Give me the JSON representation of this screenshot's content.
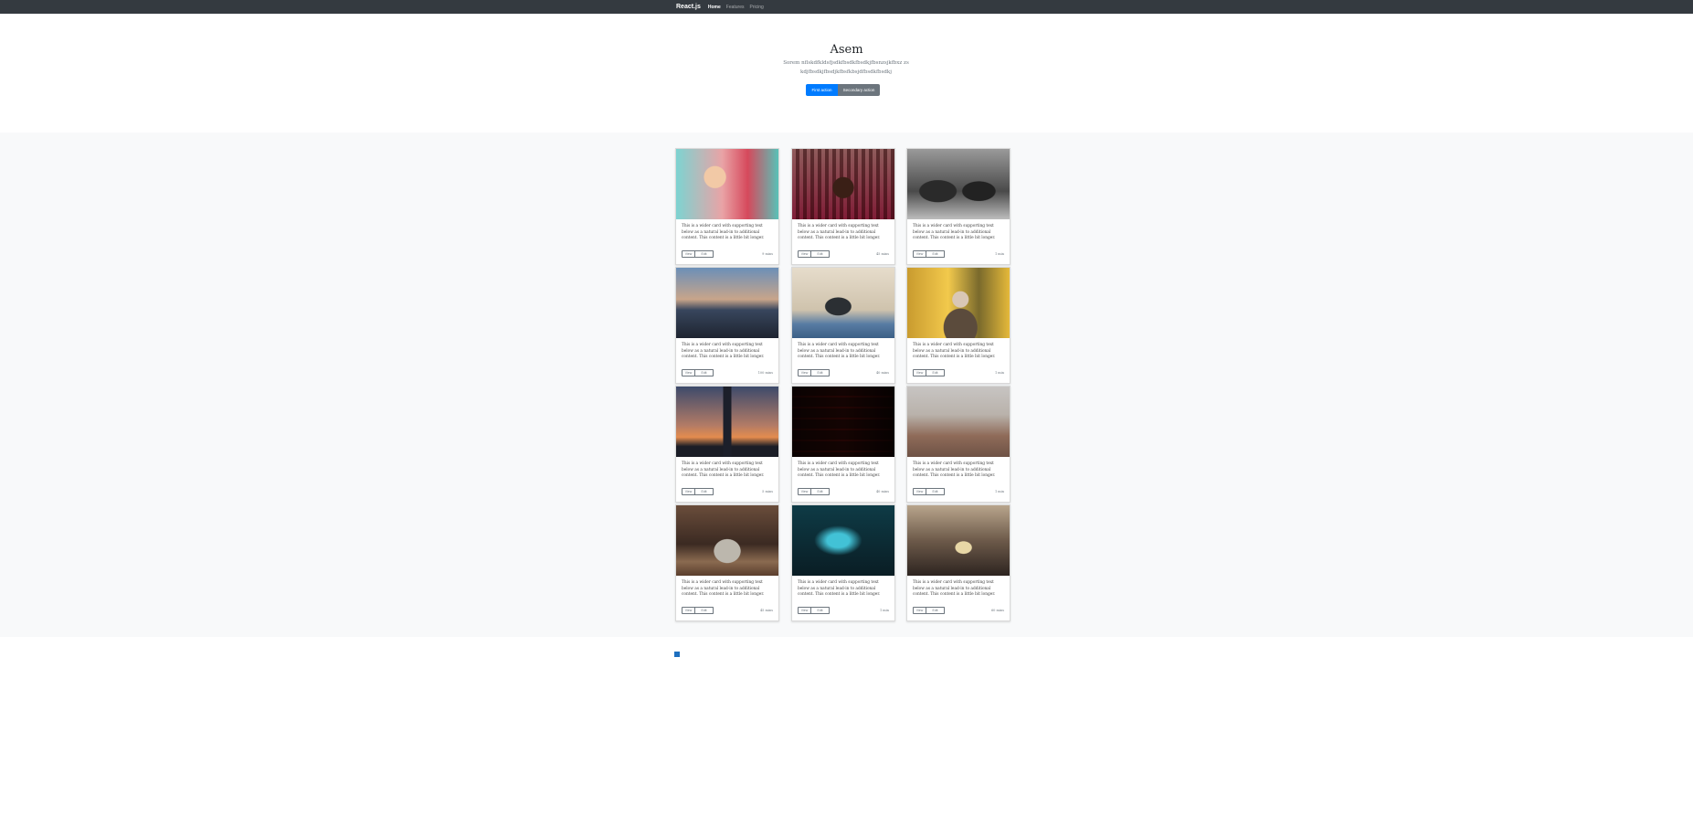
{
  "navbar": {
    "brand": "React.js",
    "links": [
      "Home",
      "Features",
      "Pricing"
    ]
  },
  "hero": {
    "title": "Asem",
    "lead": "Sorem nflskdfkldsfjsdkfbsdkfbsdkjfbsnzsjkfbxz zskdjfbsdkjfbsdjkfbsfkbsjdfbsdkfbsdkj",
    "primary_button": "First action",
    "secondary_button": "Secondary action"
  },
  "album": {
    "cards": [
      {
        "text": "This is a wider card with supporting text below as a natural lead-in to additional content. This content is a little bit longer.",
        "view": "View",
        "edit": "Edit",
        "time": "9 mins"
      },
      {
        "text": "This is a wider card with supporting text below as a natural lead-in to additional content. This content is a little bit longer.",
        "view": "View",
        "edit": "Edit",
        "time": "45 mins"
      },
      {
        "text": "This is a wider card with supporting text below as a natural lead-in to additional content. This content is a little bit longer.",
        "view": "View",
        "edit": "Edit",
        "time": "1 min"
      },
      {
        "text": "This is a wider card with supporting text below as a natural lead-in to additional content. This content is a little bit longer.",
        "view": "View",
        "edit": "Edit",
        "time": "100 mins"
      },
      {
        "text": "This is a wider card with supporting text below as a natural lead-in to additional content. This content is a little bit longer.",
        "view": "View",
        "edit": "Edit",
        "time": "40 mins"
      },
      {
        "text": "This is a wider card with supporting text below as a natural lead-in to additional content. This content is a little bit longer.",
        "view": "View",
        "edit": "Edit",
        "time": "1 min"
      },
      {
        "text": "This is a wider card with supporting text below as a natural lead-in to additional content. This content is a little bit longer.",
        "view": "View",
        "edit": "Edit",
        "time": "5 mins"
      },
      {
        "text": "This is a wider card with supporting text below as a natural lead-in to additional content. This content is a little bit longer.",
        "view": "View",
        "edit": "Edit",
        "time": "40 mins"
      },
      {
        "text": "This is a wider card with supporting text below as a natural lead-in to additional content. This content is a little bit longer.",
        "view": "View",
        "edit": "Edit",
        "time": "1 min"
      },
      {
        "text": "This is a wider card with supporting text below as a natural lead-in to additional content. This content is a little bit longer.",
        "view": "View",
        "edit": "Edit",
        "time": "45 mins"
      },
      {
        "text": "This is a wider card with supporting text below as a natural lead-in to additional content. This content is a little bit longer.",
        "view": "View",
        "edit": "Edit",
        "time": "1 min"
      },
      {
        "text": "This is a wider card with supporting text below as a natural lead-in to additional content. This content is a little bit longer.",
        "view": "View",
        "edit": "Edit",
        "time": "60 mins"
      }
    ]
  },
  "pagination": {
    "current": "1"
  }
}
